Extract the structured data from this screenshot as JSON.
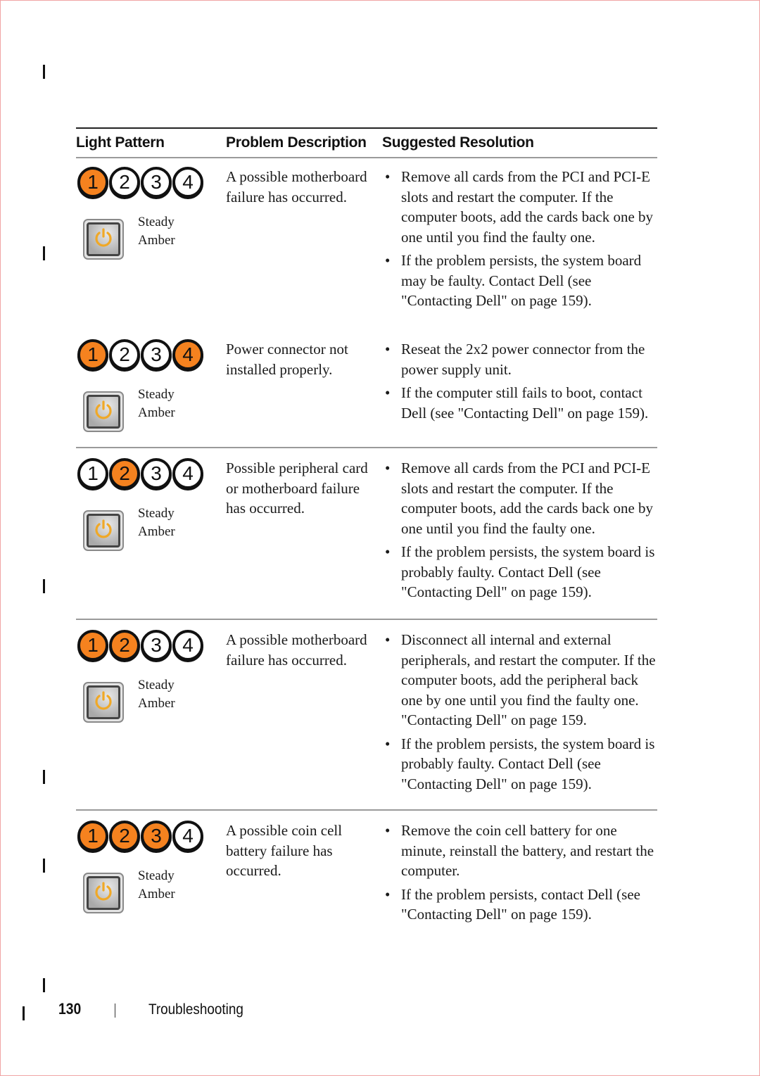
{
  "table": {
    "headers": [
      "Light Pattern",
      "Problem Description",
      "Suggested Resolution"
    ],
    "rows": [
      {
        "leds": [
          {
            "label": "1",
            "on": true
          },
          {
            "label": "2",
            "on": false
          },
          {
            "label": "3",
            "on": false
          },
          {
            "label": "4",
            "on": false
          }
        ],
        "power_state_line1": "Steady",
        "power_state_line2": "Amber",
        "problem": "A possible motherboard failure has occurred.",
        "resolutions": [
          "Remove all cards from the PCI and PCI-E slots and restart the computer. If the computer boots, add the cards back one by one until you find the faulty one.",
          "If the problem persists, the system board may be faulty. Contact Dell (see \"Contacting Dell\" on page 159)."
        ]
      },
      {
        "leds": [
          {
            "label": "1",
            "on": true
          },
          {
            "label": "2",
            "on": false
          },
          {
            "label": "3",
            "on": false
          },
          {
            "label": "4",
            "on": true
          }
        ],
        "power_state_line1": "Steady",
        "power_state_line2": "Amber",
        "problem": "Power connector not installed properly.",
        "resolutions": [
          "Reseat the 2x2 power connector from the power supply unit.",
          "If the computer still fails to boot, contact Dell (see \"Contacting Dell\" on page 159)."
        ]
      },
      {
        "leds": [
          {
            "label": "1",
            "on": false
          },
          {
            "label": "2",
            "on": true
          },
          {
            "label": "3",
            "on": false
          },
          {
            "label": "4",
            "on": false
          }
        ],
        "power_state_line1": "Steady",
        "power_state_line2": "Amber",
        "problem": "Possible peripheral card or motherboard failure has occurred.",
        "resolutions": [
          "Remove all cards from the PCI and PCI-E slots and restart the computer. If the computer boots, add the cards back one by one until you find the faulty one.",
          "If the problem persists, the system board is probably faulty. Contact Dell (see \"Contacting Dell\" on page 159)."
        ]
      },
      {
        "leds": [
          {
            "label": "1",
            "on": true
          },
          {
            "label": "2",
            "on": true
          },
          {
            "label": "3",
            "on": false
          },
          {
            "label": "4",
            "on": false
          }
        ],
        "power_state_line1": "Steady",
        "power_state_line2": "Amber",
        "problem": "A possible motherboard failure has occurred.",
        "resolutions": [
          "Disconnect all internal and external peripherals, and restart the computer. If the computer boots, add the peripheral back one by one until you find the faulty one. \"Contacting Dell\" on page 159.",
          "If the problem persists, the system board is probably faulty. Contact Dell (see \"Contacting Dell\" on page 159)."
        ]
      },
      {
        "leds": [
          {
            "label": "1",
            "on": true
          },
          {
            "label": "2",
            "on": true
          },
          {
            "label": "3",
            "on": true
          },
          {
            "label": "4",
            "on": false
          }
        ],
        "power_state_line1": "Steady",
        "power_state_line2": "Amber",
        "problem": "A possible coin cell battery failure has occurred.",
        "resolutions": [
          "Remove the coin cell battery for one minute, reinstall the battery, and restart the computer.",
          "If the problem persists, contact Dell (see \"Contacting Dell\" on page 159)."
        ]
      }
    ]
  },
  "colors": {
    "led_on": "#f5821f",
    "power_icon": "#f0a826"
  },
  "icons": {
    "bullet": "•",
    "power": "power-icon"
  },
  "footer": {
    "page_number": "130",
    "section": "Troubleshooting"
  }
}
